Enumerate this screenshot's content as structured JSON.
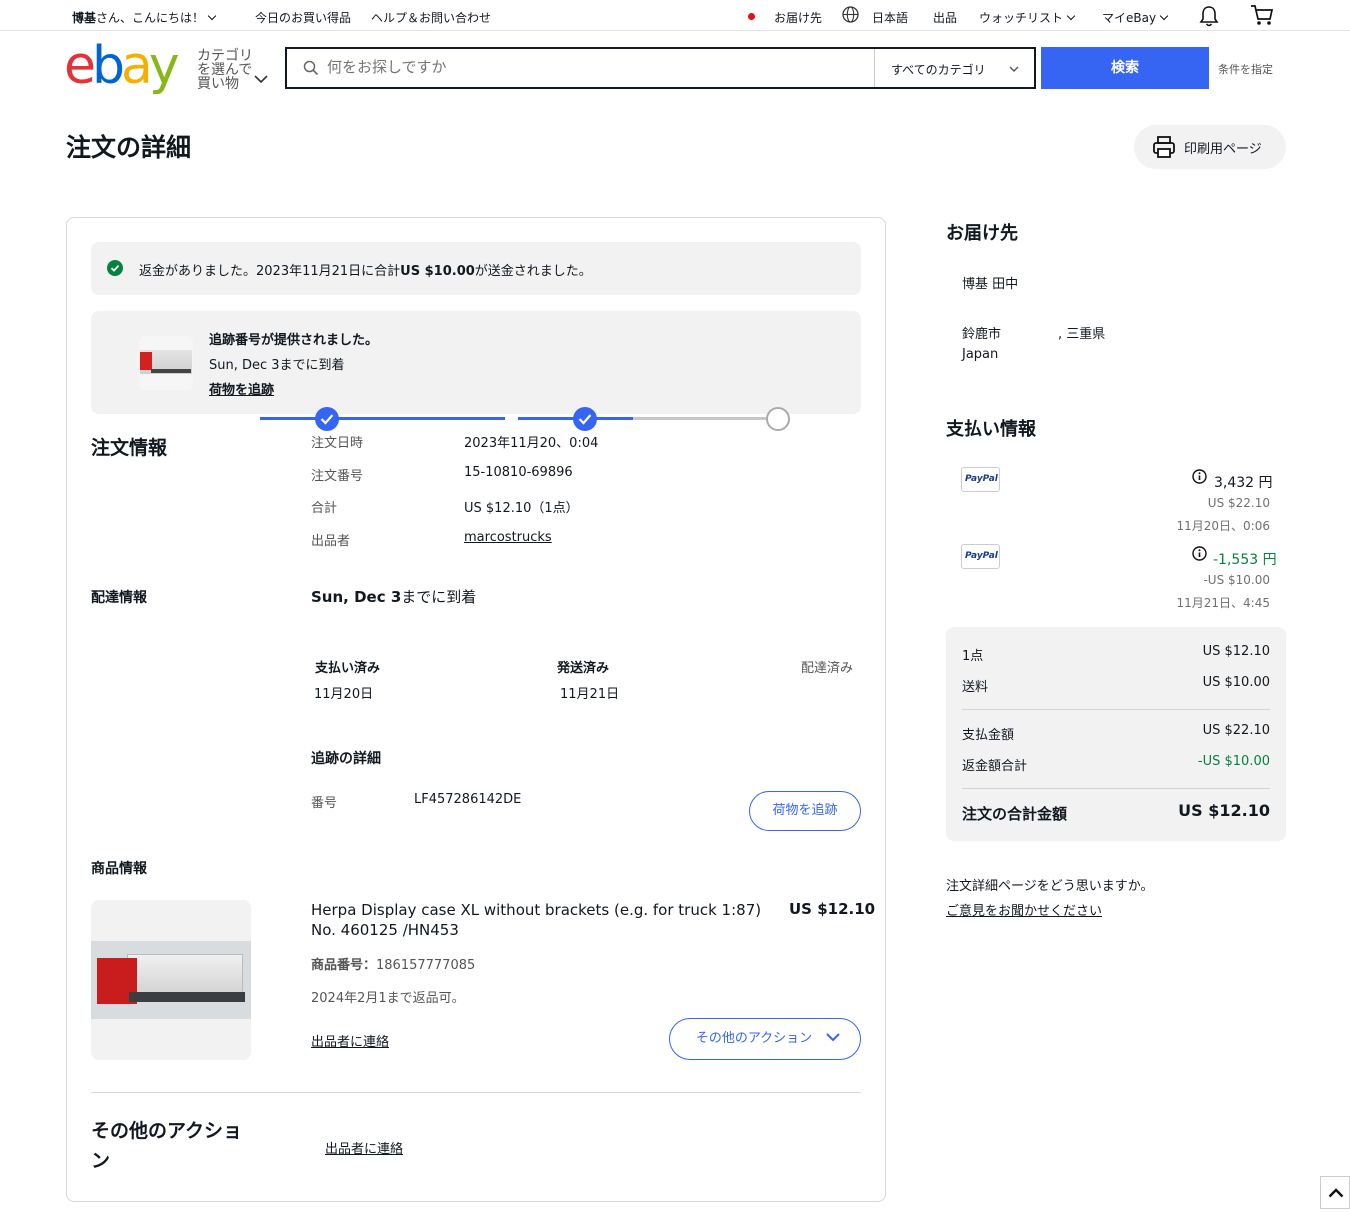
{
  "topbar": {
    "greeting_name": "博基",
    "greeting_rest": "さん、こんにちは！",
    "daily_deals": "今日のお買い得品",
    "help": "ヘルプ＆お問い合わせ",
    "ship_to": "お届け先",
    "language": "日本語",
    "sell": "出品",
    "watchlist": "ウォッチリスト",
    "my_ebay": "マイeBay"
  },
  "header": {
    "logo": {
      "e": "e",
      "b": "b",
      "a": "a",
      "y": "y"
    },
    "category_button": "カテゴリを選んで買い物",
    "search_placeholder": "何をお探しですか",
    "category_select": "すべてのカテゴリ",
    "search_button": "検索",
    "advanced": "条件を指定"
  },
  "page": {
    "title": "注文の詳細",
    "print_button": "印刷用ページ"
  },
  "refund_banner": {
    "text_before": "返金がありました。2023年11月21日に合計",
    "amount": "US $10.00",
    "text_after": "が送金されました。"
  },
  "tracking_card": {
    "title": "追跡番号が提供されました。",
    "arrival": "Sun, Dec 3までに到着",
    "link": "荷物を追跡"
  },
  "order_info": {
    "heading": "注文情報",
    "rows": [
      {
        "label": "注文日時",
        "value": "2023年11月20、0:04"
      },
      {
        "label": "注文番号",
        "value": "15-10810-69896"
      },
      {
        "label": "合計",
        "value": "US $12.10（1点）"
      },
      {
        "label": "出品者",
        "value": "marcostrucks"
      }
    ]
  },
  "delivery": {
    "heading": "配達情報",
    "arrival_bold": "Sun, Dec 3",
    "arrival_rest": "までに到着",
    "progress": 0.74,
    "steps": [
      {
        "label": "支払い済み",
        "date": "11月20日"
      },
      {
        "label": "発送済み",
        "date": "11月21日"
      },
      {
        "label": "配達済み",
        "date": ""
      }
    ],
    "tracking_heading": "追跡の詳細",
    "number_label": "番号",
    "number": "LF457286142DE",
    "track_button": "荷物を追跡"
  },
  "product": {
    "heading": "商品情報",
    "title": "Herpa Display case XL without brackets (e.g. for truck 1:87) No. 460125 /HN453",
    "price": "US $12.10",
    "item_number_label": "商品番号：",
    "item_number": "186157777085",
    "returns": "2024年2月1まで返品可。",
    "contact_seller": "出品者に連絡",
    "more_actions": "その他のアクション"
  },
  "other_actions": {
    "heading": "その他のアクション",
    "contact_seller": "出品者に連絡"
  },
  "shipping_address": {
    "heading": "お届け先",
    "name": "博基 田中",
    "city": "鈴鹿市",
    "prefecture": ", 三重県",
    "country": "Japan"
  },
  "payment": {
    "heading": "支払い情報",
    "entries": [
      {
        "brand": "PayPal",
        "yen": "3,432 円",
        "usd": "US $22.10",
        "date": "11月20日、0:06"
      },
      {
        "brand": "PayPal",
        "yen": "-1,553 円",
        "usd": "-US $10.00",
        "date": "11月21日、4:45"
      }
    ]
  },
  "summary": {
    "items_label": "1点",
    "items_value": "US $12.10",
    "shipping_label": "送料",
    "shipping_value": "US $10.00",
    "paid_label": "支払金額",
    "paid_value": "US $22.10",
    "refund_label": "返金額合計",
    "refund_value": "-US $10.00",
    "total_label": "注文の合計金額",
    "total_value": "US $12.10"
  },
  "feedback": {
    "question": "注文詳細ページをどう思いますか。",
    "link": "ご意見をお聞かせください"
  },
  "colors": {
    "accent": "#3665f3",
    "refund_green": "#05823f",
    "check_green": "#05823f"
  }
}
